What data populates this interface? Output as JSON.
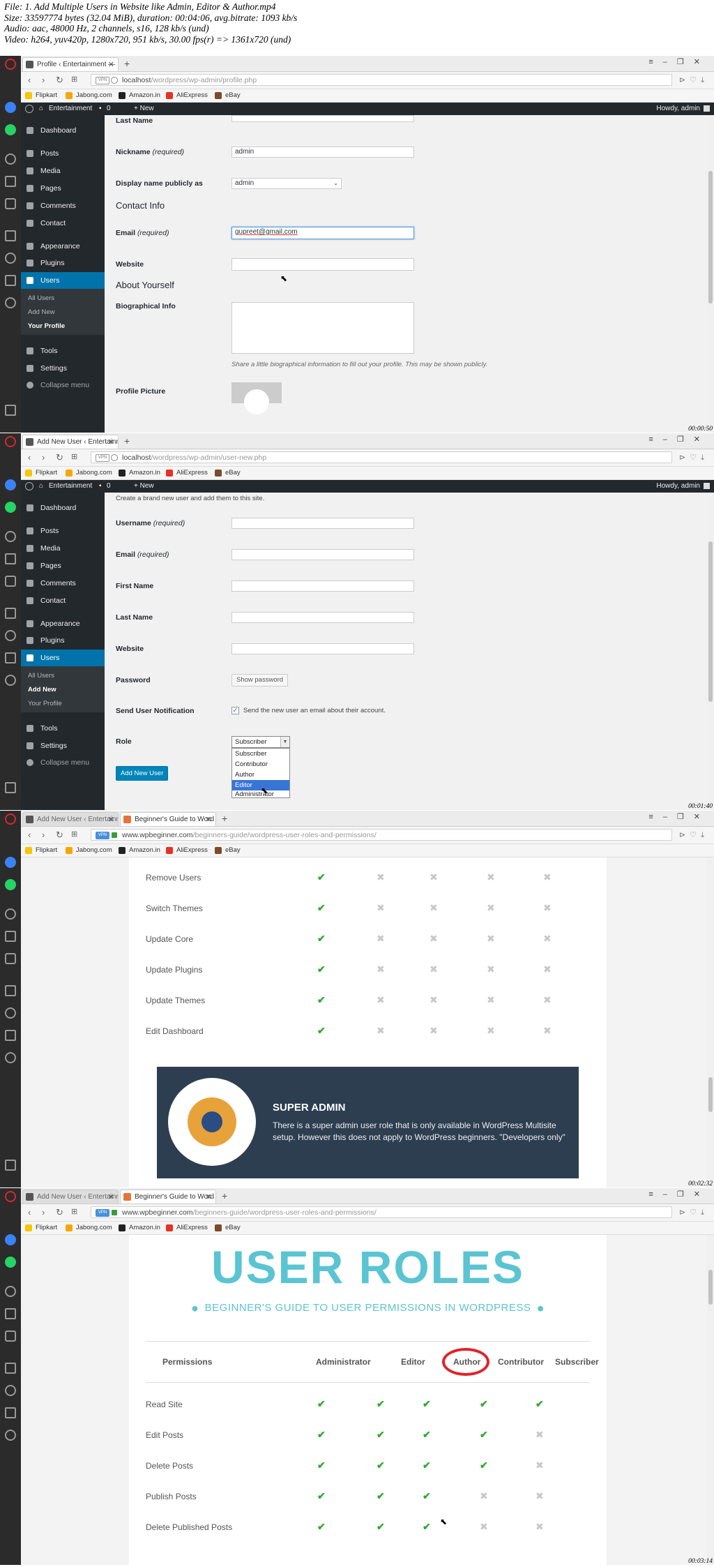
{
  "header": {
    "lines": [
      "File: 1. Add Multiple Users in Website like Admin, Editor & Author.mp4",
      "Size: 33597774 bytes (32.04 MiB), duration: 00:04:06, avg.bitrate: 1093 kb/s",
      "Audio: aac, 48000 Hz, 2 channels, s16, 128 kb/s (und)",
      "Video: h264, yuv420p, 1280x720, 951 kb/s, 30.00 fps(r) => 1361x720 (und)"
    ]
  },
  "bookmarks": [
    "Flipkart",
    "Jabong.com",
    "Amazon.in",
    "AliExpress",
    "eBay"
  ],
  "admin_bar": {
    "site": "Entertainment",
    "comments": "0",
    "new": "+ New",
    "howdy": "Howdy, admin"
  },
  "wp_menu": {
    "dashboard": "Dashboard",
    "posts": "Posts",
    "media": "Media",
    "pages": "Pages",
    "comments": "Comments",
    "contact": "Contact",
    "appearance": "Appearance",
    "plugins": "Plugins",
    "users": "Users",
    "tools": "Tools",
    "settings": "Settings",
    "collapse": "Collapse menu",
    "sub": {
      "all_users": "All Users",
      "add_new": "Add New",
      "your_profile": "Your Profile"
    }
  },
  "frame1": {
    "tab_title": "Profile ‹ Entertainment —",
    "url_host": "localhost",
    "url_path": "/wordpress/wp-admin/profile.php",
    "last_name_label": "Last Name",
    "nickname_label": "Nickname",
    "required": "(required)",
    "nickname_value": "admin",
    "display_name_label": "Display name publicly as",
    "display_name_value": "admin",
    "contact_info": "Contact Info",
    "email_label": "Email",
    "email_value": "gupreet@gmail.com",
    "website_label": "Website",
    "about_yourself": "About Yourself",
    "bio_label": "Biographical Info",
    "bio_desc": "Share a little biographical information to fill out your profile. This may be shown publicly.",
    "profile_picture": "Profile Picture",
    "timestamp": "00:00:50"
  },
  "frame2": {
    "tab_title": "Add New User ‹ Entertainm",
    "url_host": "localhost",
    "url_path": "/wordpress/wp-admin/user-new.php",
    "intro": "Create a brand new user and add them to this site.",
    "username_label": "Username",
    "email_label": "Email",
    "first_name_label": "First Name",
    "last_name_label": "Last Name",
    "website_label": "Website",
    "password_label": "Password",
    "show_password": "Show password",
    "notify_label": "Send User Notification",
    "notify_text": "Send the new user an email about their account.",
    "role_label": "Role",
    "role_value": "Subscriber",
    "role_options": [
      "Subscriber",
      "Contributor",
      "Author",
      "Editor",
      "Administrator"
    ],
    "add_button": "Add New User",
    "timestamp": "00:01:40"
  },
  "frame3": {
    "tab1_title": "Add New User ‹ Entertainm",
    "tab2_title": "Beginner's Guide to Word",
    "url_host": "www.wpbeginner.com",
    "url_path": "/beginners-guide/wordpress-user-roles-and-permissions/",
    "rows": [
      "Remove Users",
      "Switch Themes",
      "Update Core",
      "Update Plugins",
      "Update Themes",
      "Edit Dashboard"
    ],
    "banner_title": "SUPER ADMIN",
    "banner_text": "There is a super admin user role that is only available in WordPress Multisite setup. However this does not apply to WordPress beginners. \"Developers only\"",
    "timestamp": "00:02:32"
  },
  "frame4": {
    "tab1_title": "Add New User ‹ Entertainm",
    "tab2_title": "Beginner's Guide to Word",
    "url_host": "www.wpbeginner.com",
    "url_path": "/beginners-guide/wordpress-user-roles-and-permissions/",
    "title": "USER ROLES",
    "subtitle": "BEGINNER'S GUIDE TO USER PERMISSIONS IN WORDPRESS",
    "headers": [
      "Permissions",
      "Administrator",
      "Editor",
      "Author",
      "Contributor",
      "Subscriber"
    ],
    "rows": [
      {
        "name": "Read Site",
        "marks": [
          1,
          1,
          1,
          1,
          1
        ]
      },
      {
        "name": "Edit Posts",
        "marks": [
          1,
          1,
          1,
          1,
          0
        ]
      },
      {
        "name": "Delete Posts",
        "marks": [
          1,
          1,
          1,
          1,
          0
        ]
      },
      {
        "name": "Publish Posts",
        "marks": [
          1,
          1,
          1,
          0,
          0
        ]
      },
      {
        "name": "Delete Published Posts",
        "marks": [
          1,
          1,
          1,
          0,
          0
        ]
      }
    ],
    "timestamp": "00:03:14"
  },
  "colors": {
    "wp_dark": "#23282d",
    "wp_blue": "#0073aa",
    "check": "#2fa82f",
    "accent_teal": "#5bc4d2",
    "ring_red": "#e1222a"
  }
}
